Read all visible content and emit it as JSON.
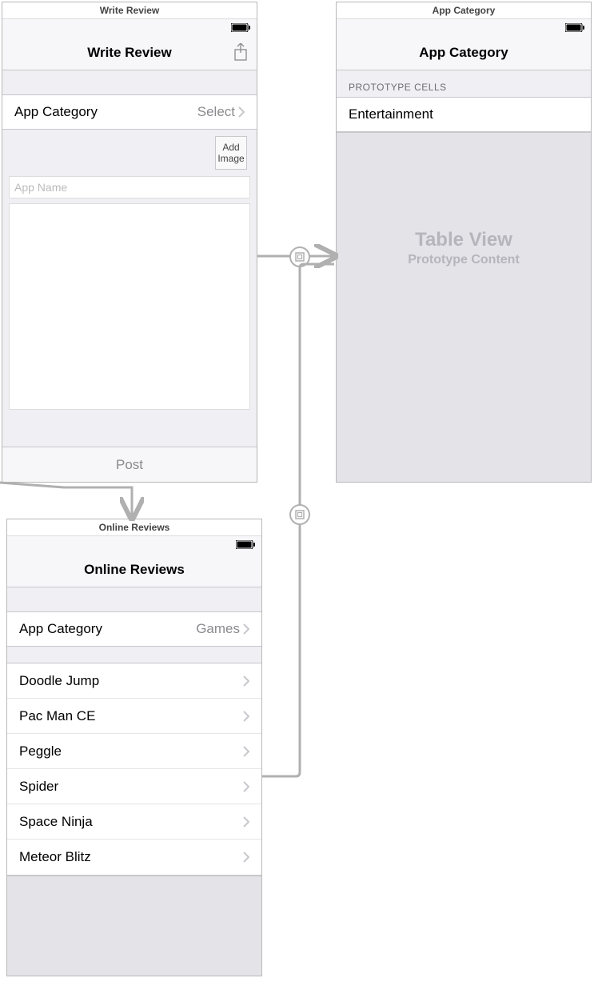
{
  "screens": {
    "writeReview": {
      "title": "Write Review",
      "navTitle": "Write Review",
      "categoryLabel": "App Category",
      "categoryValue": "Select",
      "addImageLabel": "Add Image",
      "appNamePlaceholder": "App Name",
      "postLabel": "Post"
    },
    "appCategory": {
      "title": "App Category",
      "navTitle": "App Category",
      "sectionHeader": "PROTOTYPE CELLS",
      "prototypeCell": "Entertainment",
      "placeholderTitle": "Table View",
      "placeholderSubtitle": "Prototype Content"
    },
    "onlineReviews": {
      "title": "Online Reviews",
      "navTitle": "Online Reviews",
      "categoryLabel": "App Category",
      "categoryValue": "Games",
      "items": [
        "Doodle Jump",
        "Pac Man CE",
        "Peggle",
        "Spider",
        "Space Ninja",
        "Meteor Blitz"
      ]
    }
  }
}
